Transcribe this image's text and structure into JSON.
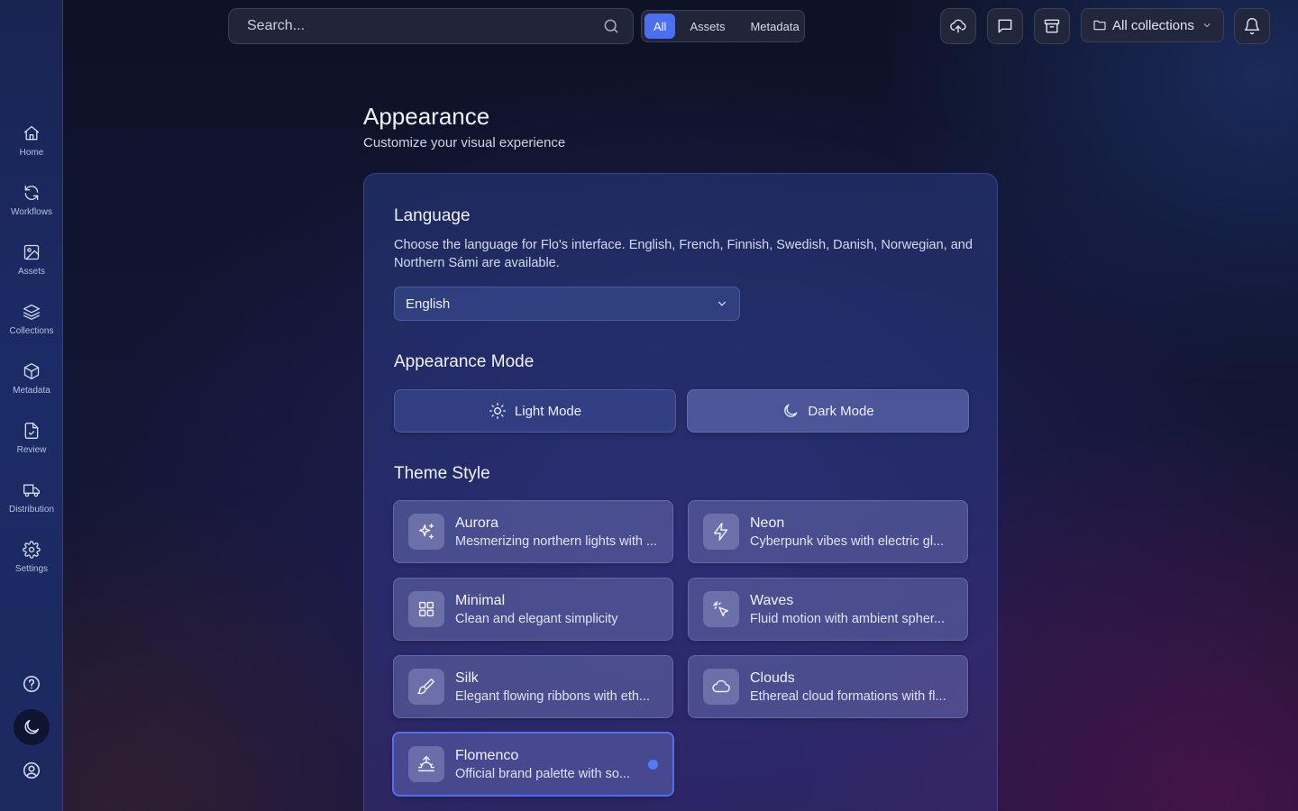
{
  "sidebar": {
    "items": [
      {
        "label": "Home",
        "icon": "home-icon"
      },
      {
        "label": "Workflows",
        "icon": "refresh-icon"
      },
      {
        "label": "Assets",
        "icon": "image-icon"
      },
      {
        "label": "Collections",
        "icon": "layers-icon"
      },
      {
        "label": "Metadata",
        "icon": "cube-icon"
      },
      {
        "label": "Review",
        "icon": "file-check-icon"
      },
      {
        "label": "Distribution",
        "icon": "truck-icon"
      },
      {
        "label": "Settings",
        "icon": "gear-icon"
      }
    ],
    "bottom": [
      "help-icon",
      "moon-icon",
      "user-circle-icon"
    ]
  },
  "topbar": {
    "search_placeholder": "Search...",
    "filters": [
      "All",
      "Assets",
      "Metadata"
    ],
    "active_filter": "All",
    "collections_label": "All collections"
  },
  "page": {
    "title": "Appearance",
    "subtitle": "Customize your visual experience"
  },
  "language": {
    "title": "Language",
    "description": "Choose the language for Flo's interface. English, French, Finnish, Swedish, Danish, Norwegian, and Northern Sámi are available.",
    "selected": "English"
  },
  "mode": {
    "title": "Appearance Mode",
    "light_label": "Light Mode",
    "dark_label": "Dark Mode",
    "active": "dark"
  },
  "themes": {
    "title": "Theme Style",
    "items": [
      {
        "name": "Aurora",
        "desc": "Mesmerizing northern lights with ...",
        "icon": "sparkles-icon"
      },
      {
        "name": "Neon",
        "desc": "Cyberpunk vibes with electric gl...",
        "icon": "lightning-icon"
      },
      {
        "name": "Minimal",
        "desc": "Clean and elegant simplicity",
        "icon": "grid-icon"
      },
      {
        "name": "Waves",
        "desc": "Fluid motion with ambient spher...",
        "icon": "cursor-click-icon"
      },
      {
        "name": "Silk",
        "desc": "Elegant flowing ribbons with eth...",
        "icon": "brush-icon"
      },
      {
        "name": "Clouds",
        "desc": "Ethereal cloud formations with fl...",
        "icon": "cloud-icon"
      },
      {
        "name": "Flomenco",
        "desc": "Official brand palette with so...",
        "icon": "sunrise-icon",
        "selected": true
      }
    ]
  },
  "colors": {
    "accent": "#4a6ff0",
    "selected_dot": "#4f7bff"
  }
}
